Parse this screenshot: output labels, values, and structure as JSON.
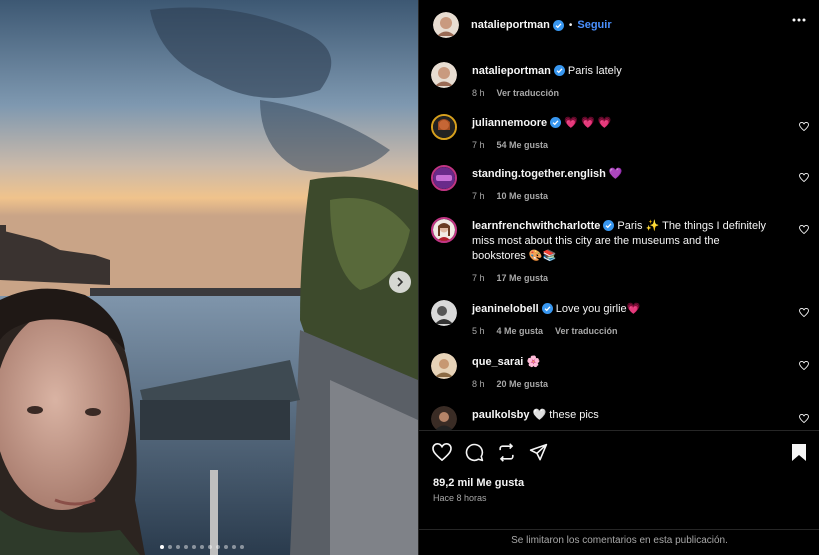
{
  "post": {
    "author": "natalieportman",
    "follow_label": "Seguir",
    "separator": "•",
    "caption": "Paris lately",
    "caption_time": "8 h",
    "caption_translate": "Ver traducción"
  },
  "comments": [
    {
      "user": "juliannemoore",
      "verified": true,
      "text": "💗 💗 💗",
      "time": "7 h",
      "likes": "54 Me gusta",
      "extra": ""
    },
    {
      "user": "standing.together.english",
      "verified": false,
      "text": "💜",
      "time": "7 h",
      "likes": "10 Me gusta",
      "extra": ""
    },
    {
      "user": "learnfrenchwithcharlotte",
      "verified": true,
      "text": "Paris ✨ The things I definitely miss most about this city are the museums and the bookstores 🎨📚",
      "time": "7 h",
      "likes": "17 Me gusta",
      "extra": ""
    },
    {
      "user": "jeaninelobell",
      "verified": true,
      "text": "Love you girlie💗",
      "time": "5 h",
      "likes": "4 Me gusta",
      "extra": "Ver traducción"
    },
    {
      "user": "que_sarai",
      "verified": false,
      "text": "🌸",
      "time": "8 h",
      "likes": "20 Me gusta",
      "extra": ""
    },
    {
      "user": "paulkolsby",
      "verified": false,
      "text": "🤍 these pics",
      "time": "",
      "likes": "",
      "extra": ""
    }
  ],
  "actions": {
    "like_count": "89,2 mil Me gusta",
    "posted": "Hace 8 horas",
    "comments_limited": "Se limitaron los comentarios en esta publicación."
  },
  "icons": {
    "more": "more-options-icon",
    "like": "heart-icon",
    "comment": "comment-icon",
    "repost": "repost-icon",
    "share": "share-icon",
    "save": "bookmark-icon",
    "next": "chevron-right-icon"
  },
  "colors": {
    "accent_blue": "#4a90ff",
    "verified": "#3897f0",
    "background": "#000000",
    "secondary_text": "#a8a8a8"
  },
  "carousel": {
    "total_slides": 11,
    "current_slide": 1
  }
}
